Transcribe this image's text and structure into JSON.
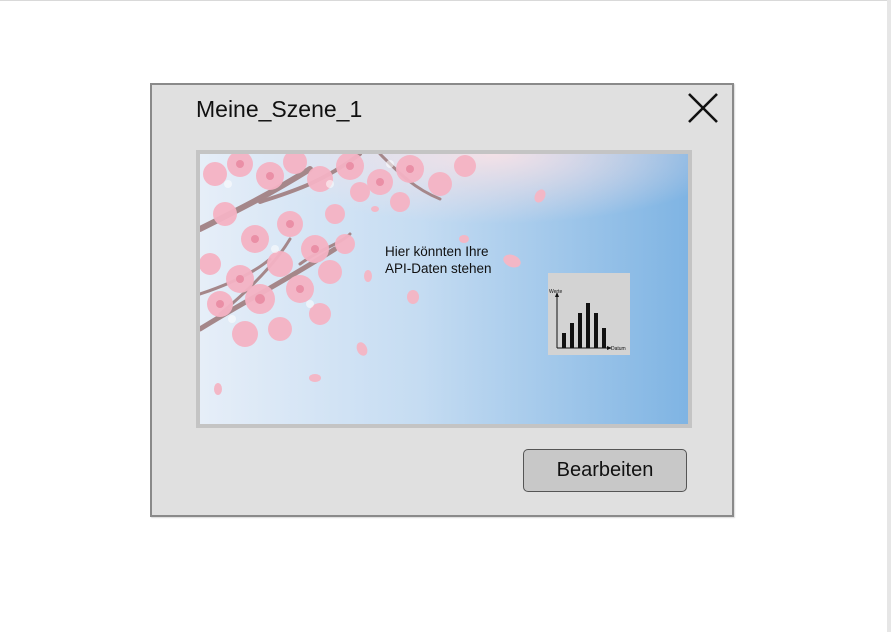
{
  "dialog": {
    "title": "Meine_Szene_1",
    "close_icon": "close-icon",
    "edit_label": "Bearbeiten"
  },
  "preview": {
    "caption_line1": "Hier könnten Ihre",
    "caption_line2": "API-Daten stehen",
    "background_theme": "cherry blossom branches on blue sky",
    "mini_chart": {
      "ylabel": "Werte",
      "xlabel": "Datum"
    }
  },
  "chart_data": {
    "type": "bar",
    "title": "",
    "xlabel": "Datum",
    "ylabel": "Werte",
    "categories": [
      "",
      "",
      "",
      "",
      "",
      ""
    ],
    "values": [
      3,
      5,
      7,
      9,
      7,
      4
    ],
    "ylim": [
      0,
      10
    ]
  },
  "colors": {
    "dialog_bg": "#e0e0e0",
    "sky_light": "#dfeaf7",
    "sky_dark": "#7fb4e3",
    "blossom": "#f5b8c8",
    "button_bg": "#c8c8c8"
  }
}
